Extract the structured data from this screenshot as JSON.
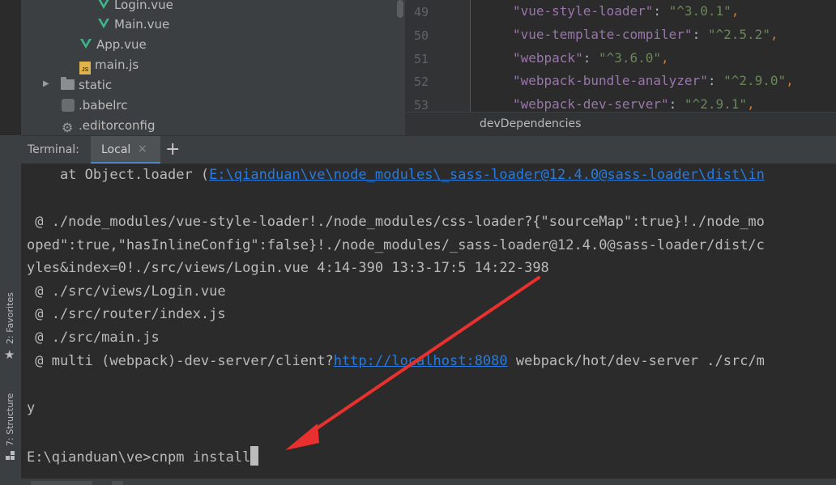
{
  "project_tree": {
    "items": [
      {
        "label": "Login.vue",
        "icon": "vue-icon"
      },
      {
        "label": "Main.vue",
        "icon": "vue-icon"
      },
      {
        "label": "App.vue",
        "icon": "vue-icon"
      },
      {
        "label": "main.js",
        "icon": "js-file-icon"
      },
      {
        "label": "static",
        "icon": "folder-icon"
      },
      {
        "label": ".babelrc",
        "icon": "babel-icon"
      },
      {
        "label": ".editorconfig",
        "icon": "gear-icon"
      }
    ]
  },
  "editor": {
    "line_numbers": [
      "49",
      "50",
      "51",
      "52",
      "53"
    ],
    "lines": [
      {
        "key": "\"vue-style-loader\"",
        "value": "\"^3.0.1\""
      },
      {
        "key": "\"vue-template-compiler\"",
        "value": "\"^2.5.2\""
      },
      {
        "key": "\"webpack\"",
        "value": "\"^3.6.0\""
      },
      {
        "key": "\"webpack-bundle-analyzer\"",
        "value": "\"^2.9.0\""
      },
      {
        "key": "\"webpack-dev-server\"",
        "value": "\"^2.9.1\""
      }
    ],
    "breadcrumb": "devDependencies"
  },
  "side_tabs": {
    "favorites": "2: Favorites",
    "structure": "7: Structure"
  },
  "terminal": {
    "header_label": "Terminal:",
    "tab_label": "Local",
    "close_glyph": "×",
    "new_tab_glyph": "+",
    "line1_prefix": "    at Object.loader (",
    "line1_link": "E:\\qianduan\\ve\\node_modules\\_sass-loader@12.4.0@sass-loader\\dist\\in",
    "line2": " @ ./node_modules/vue-style-loader!./node_modules/css-loader?{\"sourceMap\":true}!./node_mo",
    "line3": "oped\":true,\"hasInlineConfig\":false}!./node_modules/_sass-loader@12.4.0@sass-loader/dist/c",
    "line4": "yles&index=0!./src/views/Login.vue 4:14-390 13:3-17:5 14:22-398",
    "line5": " @ ./src/views/Login.vue",
    "line6": " @ ./src/router/index.js",
    "line7": " @ ./src/main.js",
    "line8_prefix": " @ multi (webpack)-dev-server/client?",
    "line8_link": "http://localhost:8080",
    "line8_suffix": " webpack/hot/dev-server ./src/m",
    "line9": "y",
    "prompt": "E:\\qianduan\\ve>cnpm install"
  },
  "colors": {
    "annotation_arrow": "#e8302e",
    "link": "#287bde",
    "vue_green": "#41b883"
  }
}
